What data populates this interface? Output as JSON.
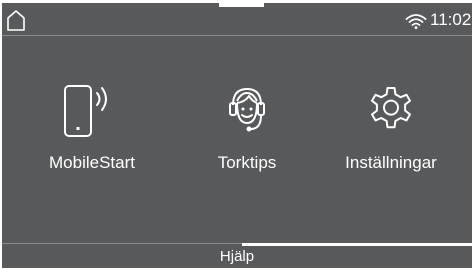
{
  "status_bar": {
    "home_icon": "home-icon",
    "wifi_icon": "wifi-icon",
    "time": "11:02"
  },
  "tiles": [
    {
      "label": "MobileStart",
      "icon": "smartphone-signal-icon"
    },
    {
      "label": "Torktips",
      "icon": "headset-support-icon"
    },
    {
      "label": "Inställningar",
      "icon": "gear-icon"
    }
  ],
  "footer": {
    "help_label": "Hjälp"
  },
  "colors": {
    "background": "#58595b",
    "foreground": "#ffffff",
    "divider": "#8b8c8e"
  }
}
